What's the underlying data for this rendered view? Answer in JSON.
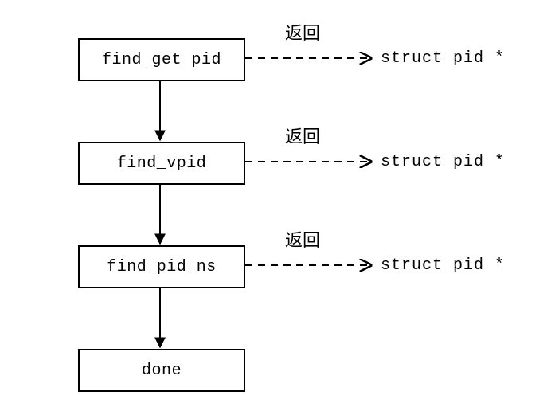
{
  "nodes": {
    "n1": "find_get_pid",
    "n2": "find_vpid",
    "n3": "find_pid_ns",
    "n4": "done"
  },
  "edges": {
    "return_label_1": "返回",
    "return_label_2": "返回",
    "return_label_3": "返回",
    "return_type_1": "struct pid *",
    "return_type_2": "struct pid *",
    "return_type_3": "struct pid *"
  }
}
